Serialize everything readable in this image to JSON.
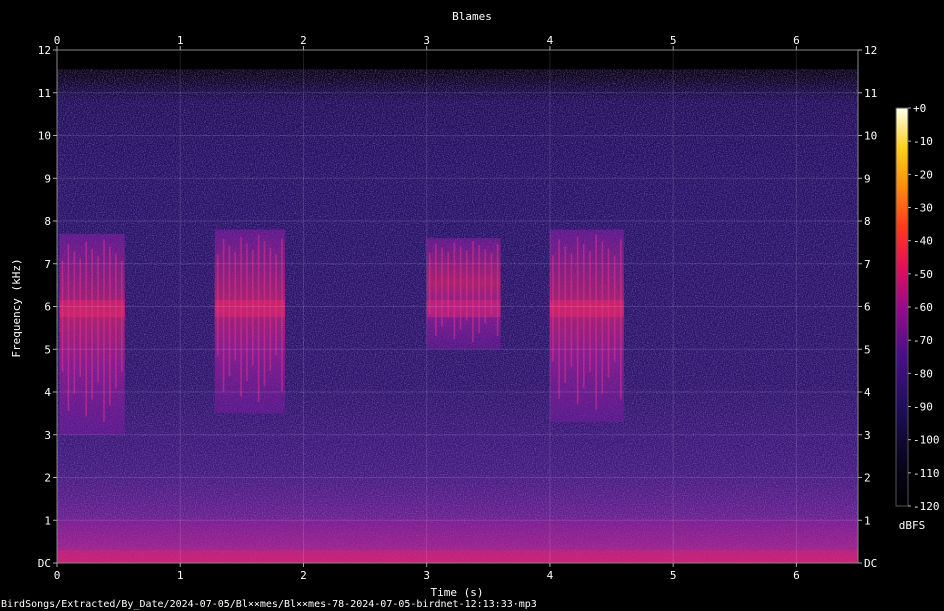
{
  "chart_data": {
    "type": "heatmap",
    "title": "Blames",
    "xlabel": "Time (s)",
    "ylabel": "Frequency (kHz)",
    "xlim": [
      0,
      6.5
    ],
    "ylim": [
      0,
      12
    ],
    "x_ticks": [
      "0",
      "1",
      "2",
      "3",
      "4",
      "5",
      "6"
    ],
    "y_ticks": [
      "DC",
      "1",
      "2",
      "3",
      "4",
      "5",
      "6",
      "7",
      "8",
      "9",
      "10",
      "11",
      "12"
    ],
    "colorbar": {
      "label": "dBFS",
      "range": [
        -120,
        0
      ],
      "ticks": [
        "+0",
        "-10",
        "-20",
        "-30",
        "-40",
        "-50",
        "-60",
        "-70",
        "-80",
        "-90",
        "-100",
        "-110",
        "-120"
      ]
    },
    "grid": true,
    "calls": [
      {
        "start": 0.02,
        "end": 0.55,
        "low_khz": 3.0,
        "high_khz": 7.7
      },
      {
        "start": 1.28,
        "end": 1.85,
        "low_khz": 3.5,
        "high_khz": 7.8
      },
      {
        "start": 3.0,
        "end": 3.6,
        "low_khz": 5.0,
        "high_khz": 7.6
      },
      {
        "start": 4.0,
        "end": 4.6,
        "low_khz": 3.3,
        "high_khz": 7.8
      }
    ]
  },
  "footer": {
    "file_path": "BirdSongs/Extracted/By_Date/2024-07-05/Bl××mes/Bl××mes-78-2024-07-05-birdnet-12:13:33·mp3"
  }
}
